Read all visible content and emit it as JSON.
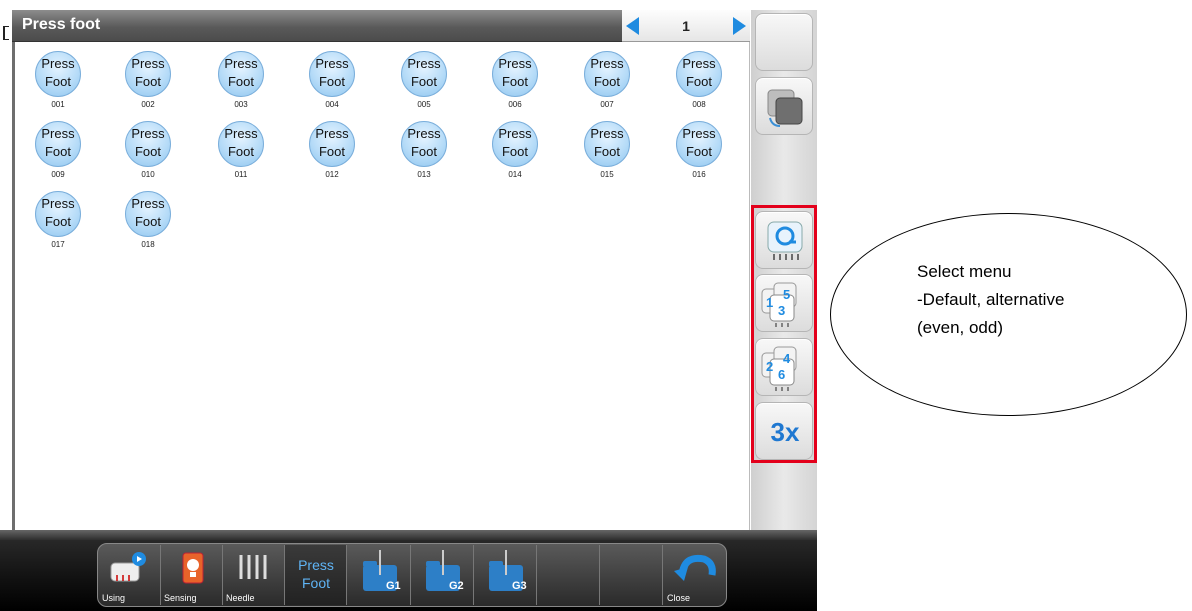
{
  "window": {
    "title": "Press foot",
    "page": "1"
  },
  "feet": [
    {
      "l1": "Press",
      "l2": "Foot",
      "num": "001"
    },
    {
      "l1": "Press",
      "l2": "Foot",
      "num": "002"
    },
    {
      "l1": "Press",
      "l2": "Foot",
      "num": "003"
    },
    {
      "l1": "Press",
      "l2": "Foot",
      "num": "004"
    },
    {
      "l1": "Press",
      "l2": "Foot",
      "num": "005"
    },
    {
      "l1": "Press",
      "l2": "Foot",
      "num": "006"
    },
    {
      "l1": "Press",
      "l2": "Foot",
      "num": "007"
    },
    {
      "l1": "Press",
      "l2": "Foot",
      "num": "008"
    },
    {
      "l1": "Press",
      "l2": "Foot",
      "num": "009"
    },
    {
      "l1": "Press",
      "l2": "Foot",
      "num": "010"
    },
    {
      "l1": "Press",
      "l2": "Foot",
      "num": "011"
    },
    {
      "l1": "Press",
      "l2": "Foot",
      "num": "012"
    },
    {
      "l1": "Press",
      "l2": "Foot",
      "num": "013"
    },
    {
      "l1": "Press",
      "l2": "Foot",
      "num": "014"
    },
    {
      "l1": "Press",
      "l2": "Foot",
      "num": "015"
    },
    {
      "l1": "Press",
      "l2": "Foot",
      "num": "016"
    },
    {
      "l1": "Press",
      "l2": "Foot",
      "num": "017"
    },
    {
      "l1": "Press",
      "l2": "Foot",
      "num": "018"
    }
  ],
  "sidebar": {
    "default_icon": "rotate-needles-icon",
    "odd_icon": "odd-sequence-icon",
    "odd_digits": [
      "1",
      "5",
      "3"
    ],
    "even_icon": "even-sequence-icon",
    "even_digits": [
      "2",
      "4",
      "6"
    ],
    "triple_label": "3x"
  },
  "bottombar": {
    "using": "Using",
    "sensing": "Sensing",
    "needle": "Needle",
    "pressfoot_l1": "Press",
    "pressfoot_l2": "Foot",
    "g1": "G1",
    "g2": "G2",
    "g3": "G3",
    "close": "Close"
  },
  "annotation": {
    "line1": "Select menu",
    "line2": "-Default, alternative",
    "line3": "(even, odd)"
  },
  "colors": {
    "accent": "#1f8be0",
    "highlight": "#e3001b",
    "foot_fill": "#b7dcf8"
  }
}
